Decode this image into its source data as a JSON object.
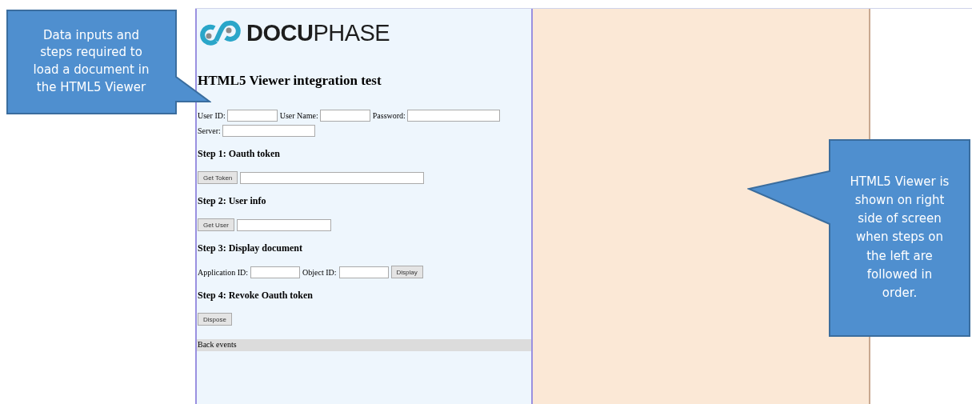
{
  "logo": {
    "text": "**DOCU**PHASE"
  },
  "heading": "HTML5 Viewer integration test",
  "credentials": [
    {
      "label": "User ID:"
    },
    {
      "label": "User Name:"
    },
    {
      "label": "Password:"
    },
    {
      "label": "Server:"
    }
  ],
  "steps": [
    {
      "title": "Step 1: Oauth token",
      "controls": [
        {
          "kind": "button",
          "label": "Get Token"
        },
        {
          "kind": "field"
        }
      ]
    },
    {
      "title": "Step 2: User info",
      "controls": [
        {
          "kind": "button",
          "label": "Get User"
        },
        {
          "kind": "field"
        }
      ]
    },
    {
      "title": "Step 3: Display document",
      "controls": [
        {
          "kind": "label",
          "label": "Application ID:"
        },
        {
          "kind": "field"
        },
        {
          "kind": "label",
          "label": "Object ID:"
        },
        {
          "kind": "field"
        },
        {
          "kind": "button",
          "label": "Display"
        }
      ]
    },
    {
      "title": "Step 4: Revoke Oauth token",
      "controls": [
        {
          "kind": "button",
          "label": "Dispose"
        }
      ]
    }
  ],
  "log": {
    "title": "Back events"
  },
  "callouts": [
    {
      "kind": "left",
      "text": "Data inputs and steps required to load a document in the HTML5 Viewer"
    },
    {
      "kind": "right",
      "text": "HTML5 Viewer is shown on right side of screen when steps on the left are followed in order."
    }
  ]
}
